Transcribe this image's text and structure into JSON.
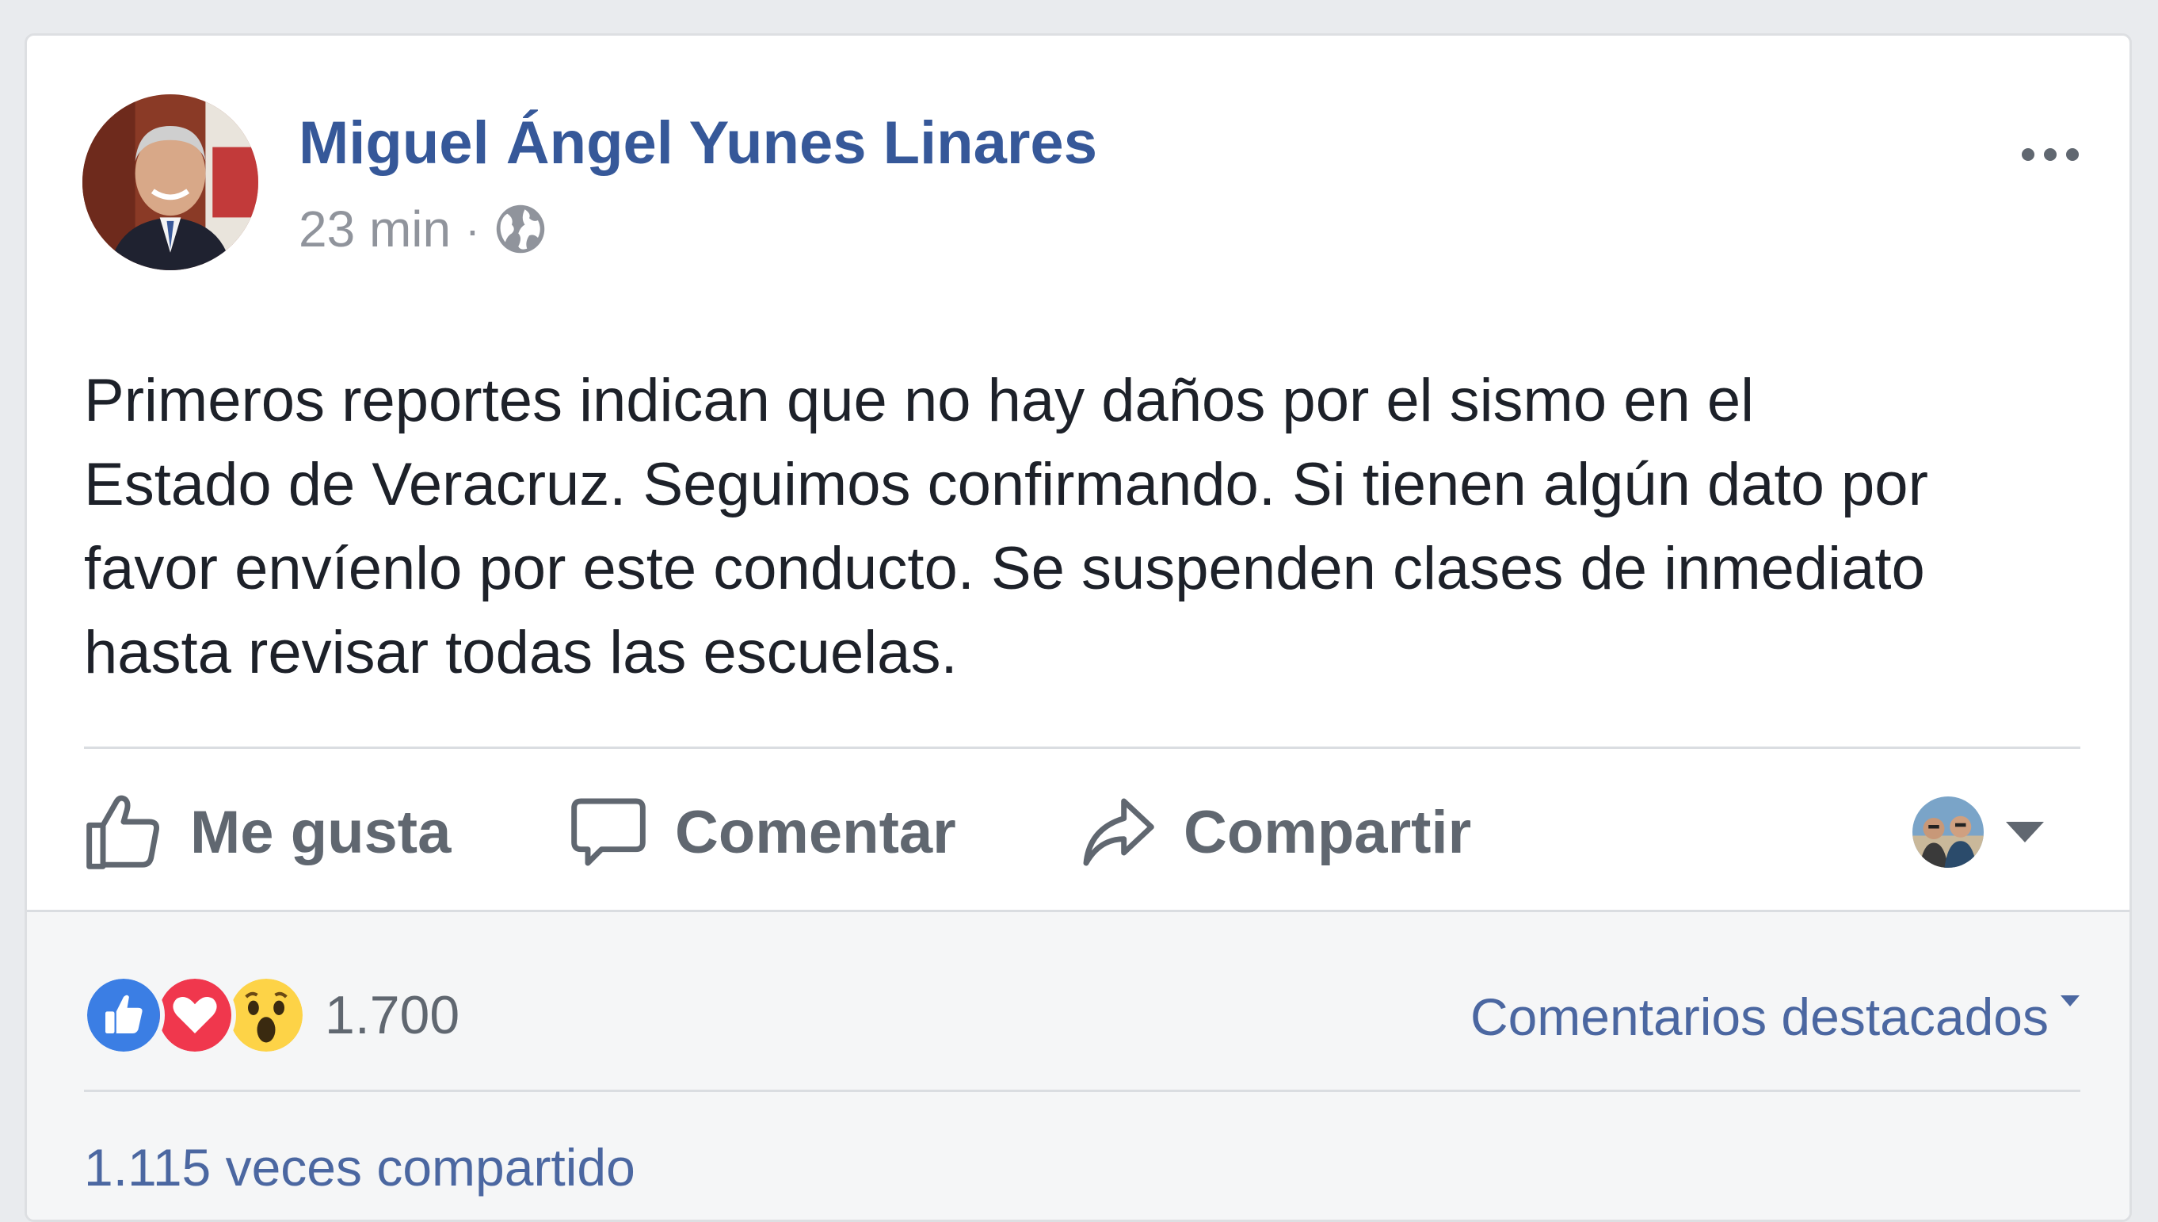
{
  "post": {
    "author_name": "Miguel Ángel Yunes Linares",
    "timestamp": "23 min",
    "separator": "·",
    "privacy_icon": "globe-icon",
    "options_icon": "more-options-icon",
    "text_lines": [
      "Primeros reportes indican que no hay daños por el sismo en el",
      "Estado de Veracruz. Seguimos confirmando. Si tienen algún dato por",
      "favor envíenlo por este conducto. Se suspenden clases de inmediato",
      "hasta revisar todas las escuelas."
    ]
  },
  "actions": {
    "like_label": "Me gusta",
    "like_icon": "thumbs-up-icon",
    "comment_label": "Comentar",
    "comment_icon": "speech-bubble-icon",
    "share_label": "Compartir",
    "share_icon": "share-arrow-icon",
    "audience_icon": "profile-avatar-icon",
    "audience_caret_icon": "caret-down-icon"
  },
  "stats": {
    "reactions": [
      "like",
      "love",
      "wow"
    ],
    "reaction_count": "1.700",
    "comments_sort_label": "Comentarios destacados",
    "share_count_label": "1.115 veces compartido"
  },
  "colors": {
    "author_link": "#365899",
    "secondary_link": "#4b67a1",
    "body_text": "#1d2129",
    "meta_text": "#90949c",
    "action_text": "#606770",
    "like_blue": "#3b7ee4",
    "love_red": "#f0374d",
    "wow_yellow": "#fdd347"
  }
}
